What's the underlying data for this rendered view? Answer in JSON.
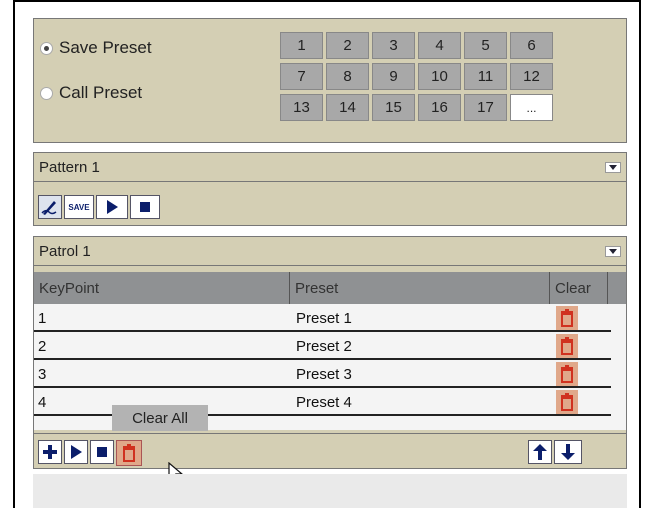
{
  "preset_panel": {
    "save_label": "Save Preset",
    "call_label": "Call Preset",
    "selected": "save",
    "buttons": [
      "1",
      "2",
      "3",
      "4",
      "5",
      "6",
      "7",
      "8",
      "9",
      "10",
      "11",
      "12",
      "13",
      "14",
      "15",
      "16",
      "17",
      "..."
    ]
  },
  "pattern": {
    "title": "Pattern 1",
    "save_icon_text": "SAVE"
  },
  "patrol": {
    "title": "Patrol 1",
    "columns": [
      "KeyPoint",
      "Preset",
      "Clear"
    ],
    "rows": [
      {
        "keypoint": "1",
        "preset": "Preset 1"
      },
      {
        "keypoint": "2",
        "preset": "Preset 2"
      },
      {
        "keypoint": "3",
        "preset": "Preset 3"
      },
      {
        "keypoint": "4",
        "preset": "Preset 4"
      }
    ],
    "tooltip": "Clear All"
  },
  "colors": {
    "panel_bg": "#d4cfb4",
    "icon_blue": "#0b1e6b",
    "trash_red": "#d0311f"
  },
  "icons": [
    "pencil-icon",
    "save-icon",
    "play-icon",
    "stop-icon",
    "plus-icon",
    "trash-icon",
    "arrow-up-icon",
    "arrow-down-icon",
    "chevron-down-icon",
    "cursor-icon"
  ]
}
